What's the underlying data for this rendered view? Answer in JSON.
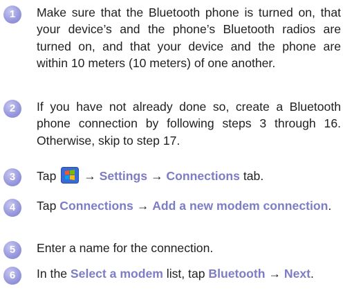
{
  "steps": [
    {
      "number": "1",
      "text": "Make sure that the Bluetooth phone is turned on, that your device’s and the phone’s Bluetooth radios are turned on, and that your device and the phone are within 10 meters (10 meters) of one another."
    },
    {
      "number": "2",
      "text": "If you have not already done so, create a Bluetooth phone connection by following steps 3 through 16. Otherwise, skip to step 17."
    },
    {
      "number": "3",
      "prefix": "Tap",
      "icon": "windows-start-icon",
      "arrow1": "→",
      "kw1": "Settings",
      "arrow2": "→",
      "kw2": "Connections",
      "suffix": "tab."
    },
    {
      "number": "4",
      "prefix": "Tap",
      "kw1": "Connections",
      "arrow": "→",
      "kw2": "Add a new modem connection",
      "suffix": "."
    },
    {
      "number": "5",
      "text": "Enter a name for the connection."
    },
    {
      "number": "6",
      "prefix": "In the",
      "kw1": "Select a modem",
      "middle": "list, tap",
      "kw2": "Bluetooth",
      "arrow": "→",
      "kw3": "Next",
      "suffix": "."
    }
  ],
  "colors": {
    "badge": "#9a9ade",
    "keyword": "#7d7dc6",
    "text": "#1f1f1f"
  }
}
